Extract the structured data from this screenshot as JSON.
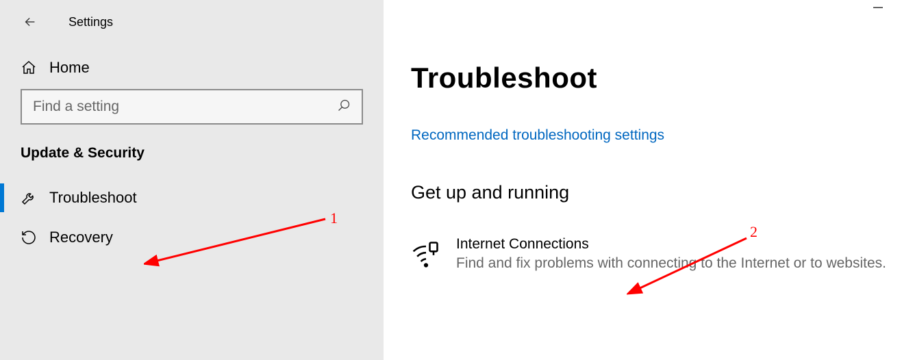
{
  "app_title": "Settings",
  "sidebar": {
    "home_label": "Home",
    "search_placeholder": "Find a setting",
    "section_label": "Update & Security",
    "items": [
      {
        "label": "Troubleshoot",
        "active": true
      },
      {
        "label": "Recovery",
        "active": false
      }
    ]
  },
  "main": {
    "page_title": "Troubleshoot",
    "link": "Recommended troubleshooting settings",
    "section_heading": "Get up and running",
    "troubleshooter": {
      "title": "Internet Connections",
      "desc": "Find and fix problems with connecting to the Internet or to websites."
    }
  },
  "annotations": {
    "label1": "1",
    "label2": "2"
  }
}
